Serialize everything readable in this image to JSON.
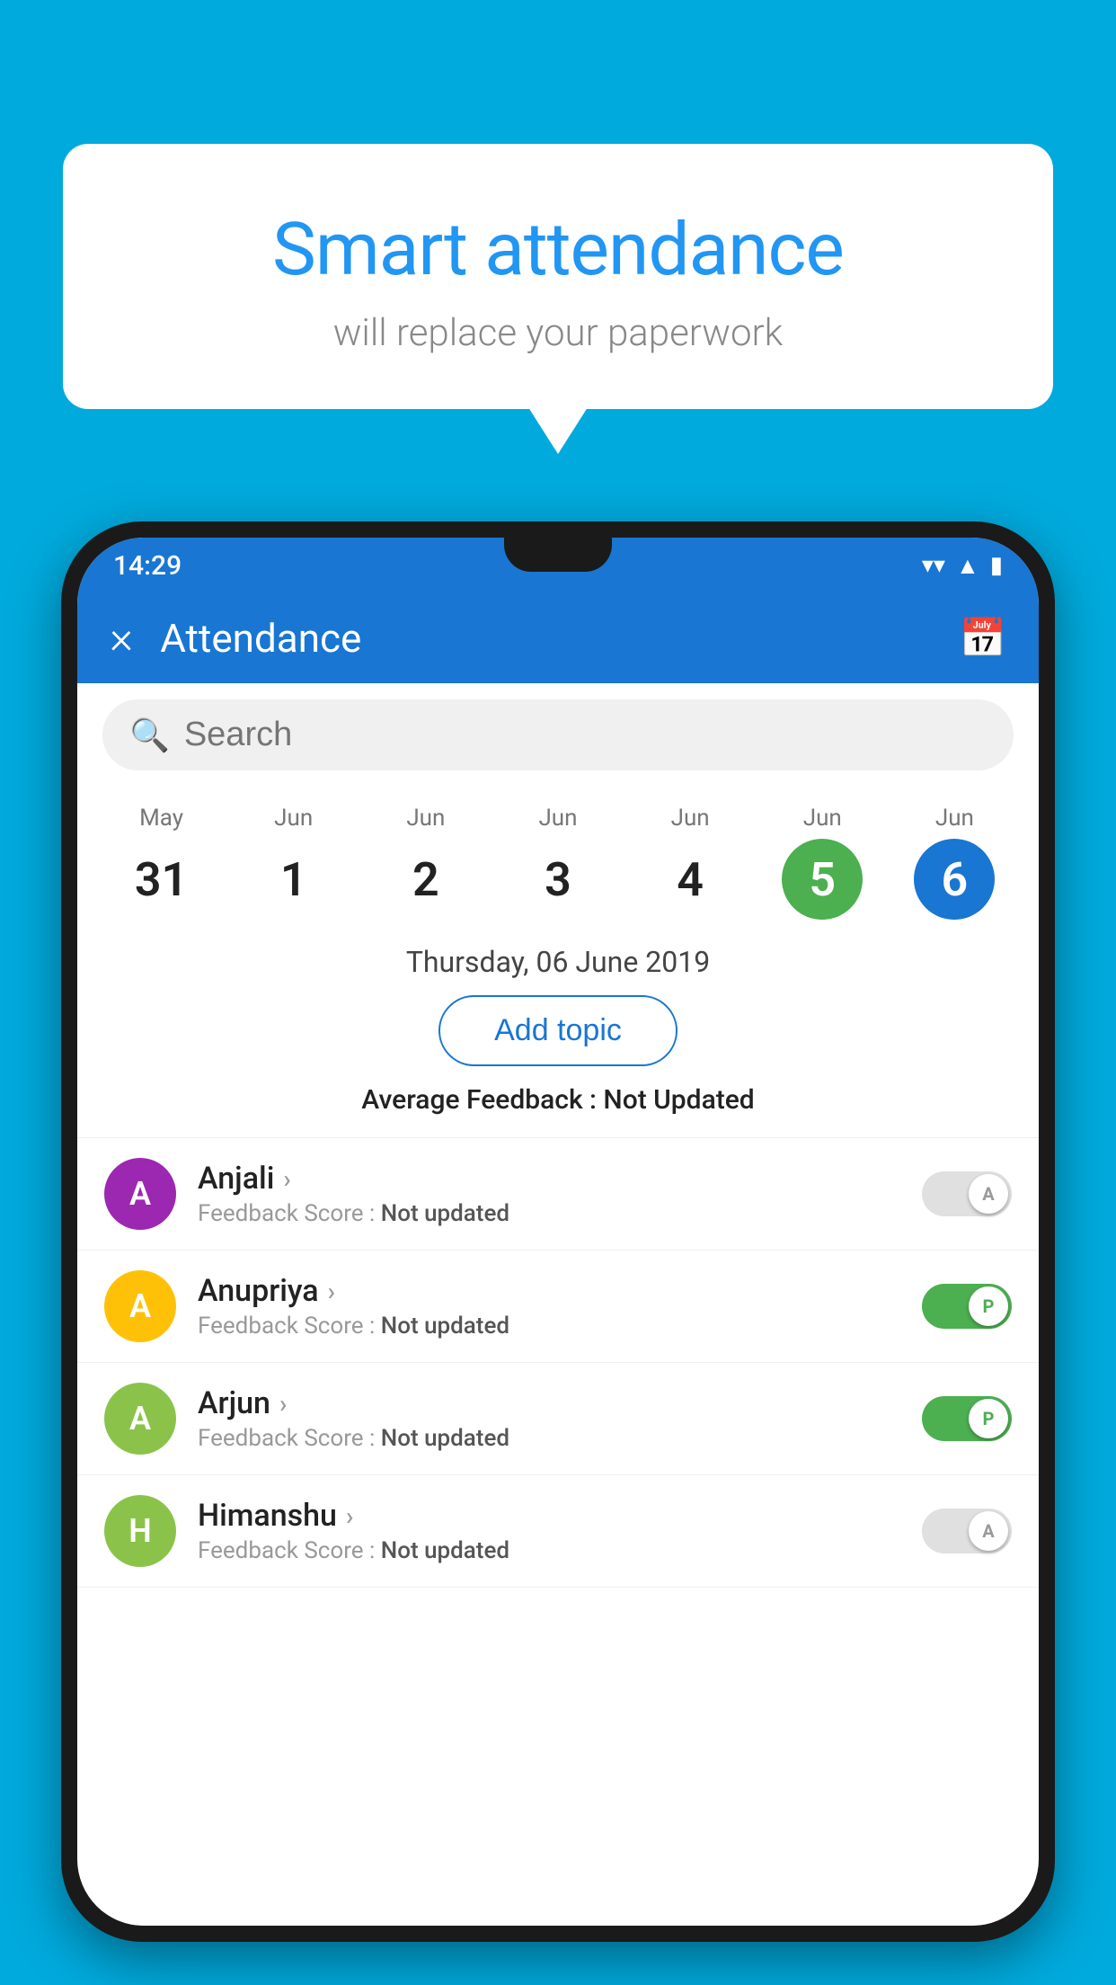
{
  "background_color": "#00AADD",
  "speech_bubble": {
    "title": "Smart attendance",
    "subtitle": "will replace your paperwork"
  },
  "phone": {
    "status_bar": {
      "time": "14:29"
    },
    "app_bar": {
      "title": "Attendance",
      "close_label": "×"
    },
    "search": {
      "placeholder": "Search"
    },
    "calendar": {
      "days": [
        {
          "month": "May",
          "number": "31",
          "state": "normal"
        },
        {
          "month": "Jun",
          "number": "1",
          "state": "normal"
        },
        {
          "month": "Jun",
          "number": "2",
          "state": "normal"
        },
        {
          "month": "Jun",
          "number": "3",
          "state": "normal"
        },
        {
          "month": "Jun",
          "number": "4",
          "state": "normal"
        },
        {
          "month": "Jun",
          "number": "5",
          "state": "today"
        },
        {
          "month": "Jun",
          "number": "6",
          "state": "selected"
        }
      ]
    },
    "selected_date": "Thursday, 06 June 2019",
    "add_topic_label": "Add topic",
    "avg_feedback_label": "Average Feedback :",
    "avg_feedback_value": "Not Updated",
    "students": [
      {
        "name": "Anjali",
        "avatar_letter": "A",
        "avatar_color": "#9C27B0",
        "feedback_label": "Feedback Score :",
        "feedback_value": "Not updated",
        "toggle_state": "off",
        "toggle_letter": "A"
      },
      {
        "name": "Anupriya",
        "avatar_letter": "A",
        "avatar_color": "#FFC107",
        "feedback_label": "Feedback Score :",
        "feedback_value": "Not updated",
        "toggle_state": "on",
        "toggle_letter": "P"
      },
      {
        "name": "Arjun",
        "avatar_letter": "A",
        "avatar_color": "#8BC34A",
        "feedback_label": "Feedback Score :",
        "feedback_value": "Not updated",
        "toggle_state": "on",
        "toggle_letter": "P"
      },
      {
        "name": "Himanshu",
        "avatar_letter": "H",
        "avatar_color": "#8BC34A",
        "feedback_label": "Feedback Score :",
        "feedback_value": "Not updated",
        "toggle_state": "off",
        "toggle_letter": "A"
      }
    ]
  }
}
